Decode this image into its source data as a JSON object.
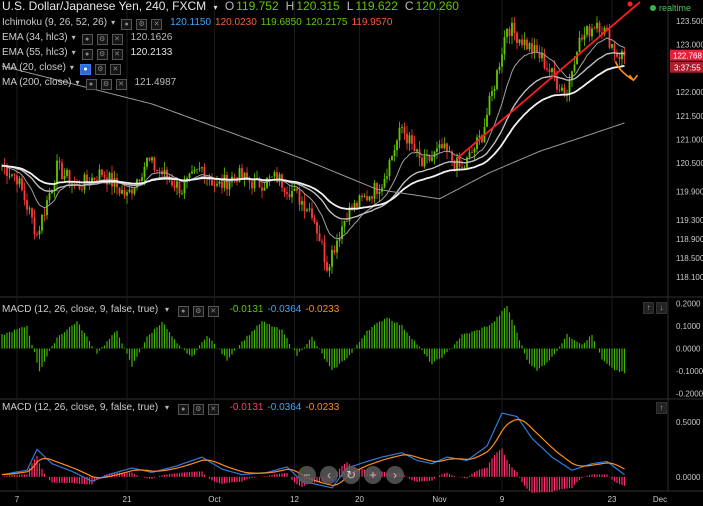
{
  "header": {
    "title": "U.S. Dollar/Japanese Yen, 240, FXCM",
    "ohlc": [
      {
        "k": "O",
        "v": "119.752"
      },
      {
        "k": "H",
        "v": "120.315"
      },
      {
        "k": "L",
        "v": "119.622"
      },
      {
        "k": "C",
        "v": "120.260"
      }
    ],
    "realtime": "realtime"
  },
  "indicators": [
    {
      "label": "Ichimoku (9, 26, 52, 26)",
      "values": [
        {
          "v": "120.1150",
          "color": "#3ea8ff"
        },
        {
          "v": "120.0230",
          "color": "#ff5c3b"
        },
        {
          "v": "119.6850",
          "color": "#62c800"
        },
        {
          "v": "120.2175",
          "color": "#62c800"
        },
        {
          "v": "119.9570",
          "color": "#ff5c3b"
        }
      ]
    },
    {
      "label": "EMA (34, hlc3)",
      "values": [
        {
          "v": "120.1626",
          "color": "#bbbbbb"
        }
      ]
    },
    {
      "label": "EMA (55, hlc3)",
      "values": [
        {
          "v": "120.2133",
          "color": "#e0e0e0"
        }
      ]
    },
    {
      "label": "MA (20, close)",
      "values": []
    },
    {
      "label": "MA (200, close)",
      "values": [
        {
          "v": "121.4987",
          "color": "#bbbbbb"
        }
      ]
    }
  ],
  "macd1": {
    "label": "MACD (12, 26, close, 9, false, true)",
    "values": [
      {
        "v": "-0.0131",
        "color": "#62c800"
      },
      {
        "v": "-0.0364",
        "color": "#3ea8ff"
      },
      {
        "v": "-0.0233",
        "color": "#ff8c1a"
      }
    ]
  },
  "macd2": {
    "label": "MACD (12, 26, close, 9, false, true)",
    "values": [
      {
        "v": "-0.0131",
        "color": "#ff3c6e"
      },
      {
        "v": "-0.0364",
        "color": "#3ea8ff"
      },
      {
        "v": "-0.0233",
        "color": "#ff8c1a"
      }
    ]
  },
  "price_tags": {
    "last": "122.768",
    "countdown": "3:37:55"
  },
  "colors": {
    "up": "#62c800",
    "down": "#ff3c3c",
    "trend": "#ff1e1e",
    "arrow": "#ff8c1a",
    "macdHistUp": "#43b300",
    "macd2Hist": "#ff2f6e",
    "macdLine": "#2f7bd9",
    "signal": "#ff8c1a",
    "grid": "#1b1b1b",
    "axisText": "#c8c8c8",
    "border": "#2a2a2a"
  },
  "chart_data": {
    "type": "candlestick",
    "x_tick_labels": [
      "7",
      "21",
      "Oct",
      "12",
      "20",
      "Nov",
      "9",
      "23",
      "Dec"
    ],
    "x_tick_index": [
      6,
      50,
      85,
      117,
      143,
      175,
      200,
      244,
      270
    ],
    "n_bars": 250,
    "price_axis": {
      "ylim": [
        117.7,
        123.9
      ],
      "ticks": [
        "123.500",
        "123.000",
        "122.500",
        "122.000",
        "121.500",
        "121.000",
        "120.500",
        "119.900",
        "119.300",
        "118.900",
        "118.500",
        "118.100"
      ]
    },
    "macd1_axis": {
      "ylim": [
        -0.22,
        0.22
      ],
      "ticks": [
        "0.2000",
        "0.1000",
        "0.0000",
        "-0.1000",
        "-0.2000"
      ]
    },
    "macd2_axis": {
      "ylim": [
        -0.12,
        0.7
      ],
      "ticks": [
        "0.5000",
        "0.0000"
      ]
    },
    "close_anchors": [
      [
        0,
        120.45
      ],
      [
        6,
        120.2
      ],
      [
        14,
        119.0
      ],
      [
        22,
        120.4
      ],
      [
        30,
        120.0
      ],
      [
        40,
        120.3
      ],
      [
        50,
        119.8
      ],
      [
        58,
        120.55
      ],
      [
        66,
        120.2
      ],
      [
        72,
        119.95
      ],
      [
        80,
        120.4
      ],
      [
        86,
        120.0
      ],
      [
        94,
        120.25
      ],
      [
        102,
        120.05
      ],
      [
        110,
        120.2
      ],
      [
        118,
        119.8
      ],
      [
        124,
        119.5
      ],
      [
        130,
        118.35
      ],
      [
        138,
        119.45
      ],
      [
        146,
        119.8
      ],
      [
        152,
        120.1
      ],
      [
        160,
        121.25
      ],
      [
        168,
        120.45
      ],
      [
        176,
        120.8
      ],
      [
        184,
        120.35
      ],
      [
        192,
        121.1
      ],
      [
        198,
        122.4
      ],
      [
        202,
        123.4
      ],
      [
        208,
        123.1
      ],
      [
        216,
        122.7
      ],
      [
        222,
        122.2
      ],
      [
        226,
        122.0
      ],
      [
        230,
        123.0
      ],
      [
        238,
        123.5
      ],
      [
        242,
        123.2
      ],
      [
        246,
        122.8
      ],
      [
        249,
        122.77
      ]
    ],
    "ma200_anchors": [
      [
        0,
        122.55
      ],
      [
        60,
        121.75
      ],
      [
        120,
        120.6
      ],
      [
        150,
        119.95
      ],
      [
        175,
        119.75
      ],
      [
        195,
        120.3
      ],
      [
        215,
        120.75
      ],
      [
        235,
        121.1
      ],
      [
        249,
        121.35
      ]
    ],
    "macd1_anchors": [
      [
        0,
        0.06
      ],
      [
        10,
        0.1
      ],
      [
        15,
        -0.1
      ],
      [
        22,
        0.05
      ],
      [
        30,
        0.12
      ],
      [
        38,
        -0.02
      ],
      [
        46,
        0.08
      ],
      [
        52,
        -0.08
      ],
      [
        58,
        0.05
      ],
      [
        64,
        0.12
      ],
      [
        70,
        0.02
      ],
      [
        76,
        -0.04
      ],
      [
        82,
        0.06
      ],
      [
        90,
        -0.05
      ],
      [
        96,
        0.03
      ],
      [
        104,
        0.12
      ],
      [
        112,
        0.08
      ],
      [
        118,
        -0.03
      ],
      [
        124,
        0.05
      ],
      [
        132,
        -0.1
      ],
      [
        140,
        -0.02
      ],
      [
        146,
        0.08
      ],
      [
        154,
        0.14
      ],
      [
        160,
        0.1
      ],
      [
        166,
        0.02
      ],
      [
        172,
        -0.07
      ],
      [
        178,
        -0.02
      ],
      [
        184,
        0.06
      ],
      [
        190,
        0.08
      ],
      [
        196,
        0.11
      ],
      [
        202,
        0.19
      ],
      [
        206,
        0.07
      ],
      [
        210,
        -0.05
      ],
      [
        214,
        -0.1
      ],
      [
        220,
        -0.04
      ],
      [
        226,
        0.06
      ],
      [
        232,
        0.02
      ],
      [
        236,
        0.06
      ],
      [
        240,
        -0.05
      ],
      [
        244,
        -0.09
      ],
      [
        249,
        -0.11
      ]
    ],
    "macd2_anchors": [
      [
        0,
        0.02
      ],
      [
        10,
        0.06
      ],
      [
        14,
        0.25
      ],
      [
        20,
        0.12
      ],
      [
        28,
        0.05
      ],
      [
        36,
        -0.04
      ],
      [
        44,
        0.03
      ],
      [
        52,
        0.08
      ],
      [
        60,
        0.04
      ],
      [
        70,
        0.1
      ],
      [
        80,
        0.18
      ],
      [
        88,
        0.07
      ],
      [
        96,
        0.02
      ],
      [
        106,
        0.04
      ],
      [
        114,
        0.09
      ],
      [
        120,
        -0.04
      ],
      [
        126,
        -0.07
      ],
      [
        132,
        -0.1
      ],
      [
        138,
        0.08
      ],
      [
        146,
        0.14
      ],
      [
        152,
        0.18
      ],
      [
        160,
        0.22
      ],
      [
        166,
        0.15
      ],
      [
        172,
        0.12
      ],
      [
        178,
        0.18
      ],
      [
        186,
        0.15
      ],
      [
        194,
        0.28
      ],
      [
        200,
        0.58
      ],
      [
        206,
        0.55
      ],
      [
        212,
        0.35
      ],
      [
        220,
        0.18
      ],
      [
        228,
        0.06
      ],
      [
        236,
        0.12
      ],
      [
        242,
        0.14
      ],
      [
        249,
        0.02
      ]
    ],
    "trendline": [
      [
        182,
        120.6
      ],
      [
        268,
        123.9
      ]
    ],
    "trend_arrow": [
      [
        243,
        122.65
      ],
      [
        249,
        122.25
      ]
    ]
  }
}
